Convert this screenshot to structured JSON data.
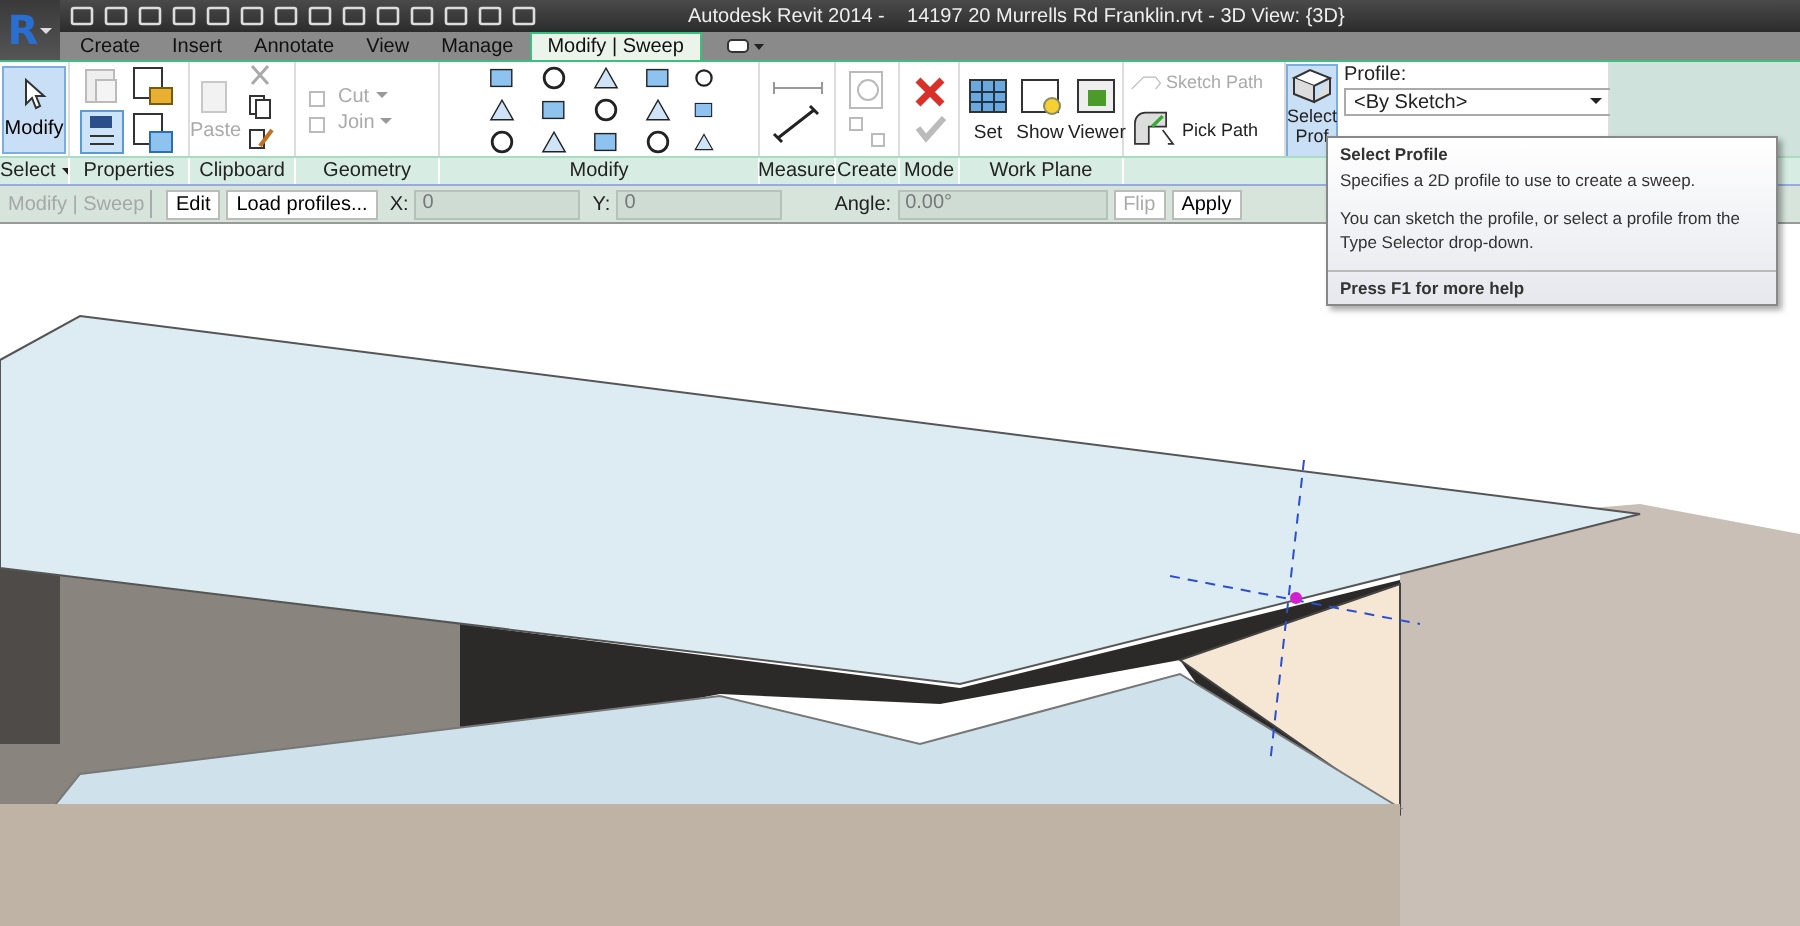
{
  "app_button": {
    "logo": "R"
  },
  "title_bar": {
    "title": "Autodesk Revit 2014 -    14197 20 Murrells Rd Franklin.rvt - 3D View: {3D}"
  },
  "tabs": [
    {
      "label": "Create",
      "selected": false
    },
    {
      "label": "Insert",
      "selected": false
    },
    {
      "label": "Annotate",
      "selected": false
    },
    {
      "label": "View",
      "selected": false
    },
    {
      "label": "Manage",
      "selected": false
    },
    {
      "label": "Modify | Sweep",
      "selected": true
    }
  ],
  "ribbon": {
    "modify_button": {
      "label": "Modify",
      "selected": true
    },
    "paste": {
      "label": "Paste",
      "disabled": true
    },
    "cut": {
      "label": "Cut",
      "disabled": true
    },
    "join": {
      "label": "Join",
      "disabled": true
    },
    "work_plane": [
      {
        "label": "Set"
      },
      {
        "label": "Show"
      },
      {
        "label": "Viewer"
      }
    ],
    "sketch_path": {
      "label": "Sketch Path",
      "disabled": true
    },
    "pick_path": {
      "label": "Pick Path",
      "disabled": false
    },
    "select_profile": {
      "label_lines": [
        "Select",
        "Prof"
      ],
      "selected": true
    },
    "profile": {
      "label": "Profile:",
      "value": "<By Sketch>"
    },
    "panels": [
      {
        "label": "Select",
        "dropdown": true
      },
      {
        "label": "Properties",
        "dropdown": false
      },
      {
        "label": "Clipboard",
        "dropdown": false
      },
      {
        "label": "Geometry",
        "dropdown": false
      },
      {
        "label": "Modify",
        "dropdown": false
      },
      {
        "label": "Measure",
        "dropdown": false
      },
      {
        "label": "Create",
        "dropdown": false
      },
      {
        "label": "Mode",
        "dropdown": false
      },
      {
        "label": "Work Plane",
        "dropdown": false
      }
    ]
  },
  "options_bar": {
    "context": "Modify | Sweep",
    "buttons": [
      {
        "label": "Edit",
        "disabled": false
      },
      {
        "label": "Load profiles...",
        "disabled": false
      }
    ],
    "fields": [
      {
        "label": "X:",
        "value": "0"
      },
      {
        "label": "Y:",
        "value": "0"
      },
      {
        "label": "Angle:",
        "value": "0.00°"
      }
    ],
    "flip": {
      "label": "Flip",
      "disabled": true
    },
    "apply": {
      "label": "Apply",
      "disabled": false
    }
  },
  "tooltip": {
    "title": "Select Profile",
    "paragraphs": [
      "Specifies a 2D profile to use to create a sweep.",
      "You can sketch the profile, or select a profile from the Type Selector drop-down."
    ],
    "footer": "Press F1 for more help"
  }
}
